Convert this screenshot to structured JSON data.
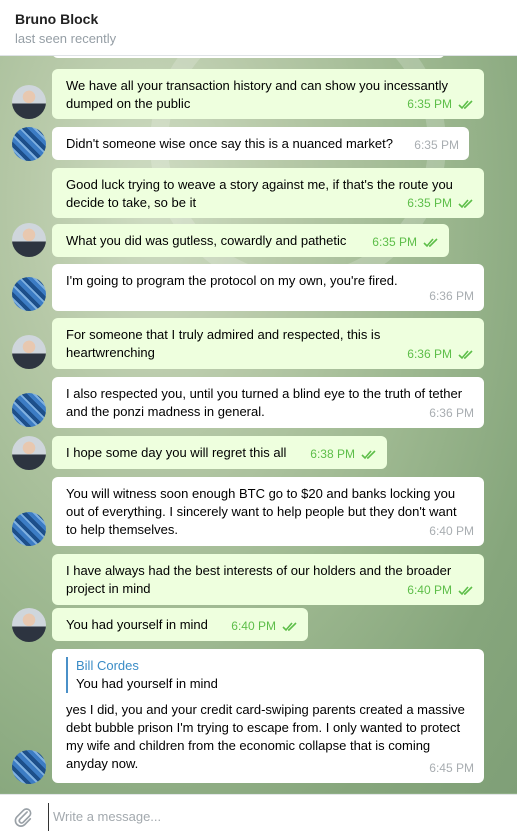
{
  "header": {
    "name": "Bruno Block",
    "status": "last seen recently"
  },
  "messages": [
    {
      "dir": "out",
      "text": "We have all your transaction history and can show you incessantly dumped on the public",
      "time": "6:35 PM"
    },
    {
      "dir": "in",
      "text": "Didn't someone wise once say this is a nuanced market?",
      "time": "6:35 PM"
    },
    {
      "dir": "out",
      "text": "Good luck trying to weave a story against me, if that's the route you decide to take, so be it",
      "time": "6:35 PM"
    },
    {
      "dir": "out",
      "text": "What you did was gutless, cowardly and pathetic",
      "time": "6:35 PM"
    },
    {
      "dir": "in",
      "text": "I'm going to program the protocol on my own, you're fired.",
      "time": "6:36 PM"
    },
    {
      "dir": "out",
      "text": "For someone that I truly admired and respected, this is heartwrenching",
      "time": "6:36 PM"
    },
    {
      "dir": "in",
      "text": "I also respected you, until you turned a blind eye to the truth of tether and the ponzi madness in general.",
      "time": "6:36 PM"
    },
    {
      "dir": "out",
      "text": "I hope some day you will regret this all",
      "time": "6:38 PM"
    },
    {
      "dir": "in",
      "text": "You will witness soon enough BTC go to $20 and banks locking you out of everything. I sincerely want to help people but they don't want to help themselves.",
      "time": "6:40 PM"
    },
    {
      "dir": "out",
      "text": "I have always had the best interests of our holders and the broader project in mind",
      "time": "6:40 PM"
    },
    {
      "dir": "out",
      "text": "You had yourself in mind",
      "time": "6:40 PM"
    },
    {
      "dir": "in",
      "quote_name": "Bill Cordes",
      "quote_text": "You had yourself in mind",
      "text": "yes I did, you and your credit card-swiping parents created a massive debt bubble prison I'm trying to escape from. I only wanted to protect my wife and children from the economic collapse that is coming anyday now.",
      "time": "6:45 PM"
    }
  ],
  "composer": {
    "placeholder": "Write a message..."
  },
  "icons": {
    "attach": "paperclip-icon",
    "read": "double-check-icon"
  },
  "colors": {
    "outgoing_bubble": "#eeffde",
    "incoming_bubble": "#ffffff",
    "check": "#5dbe49",
    "quote_accent": "#3a8cc6"
  }
}
